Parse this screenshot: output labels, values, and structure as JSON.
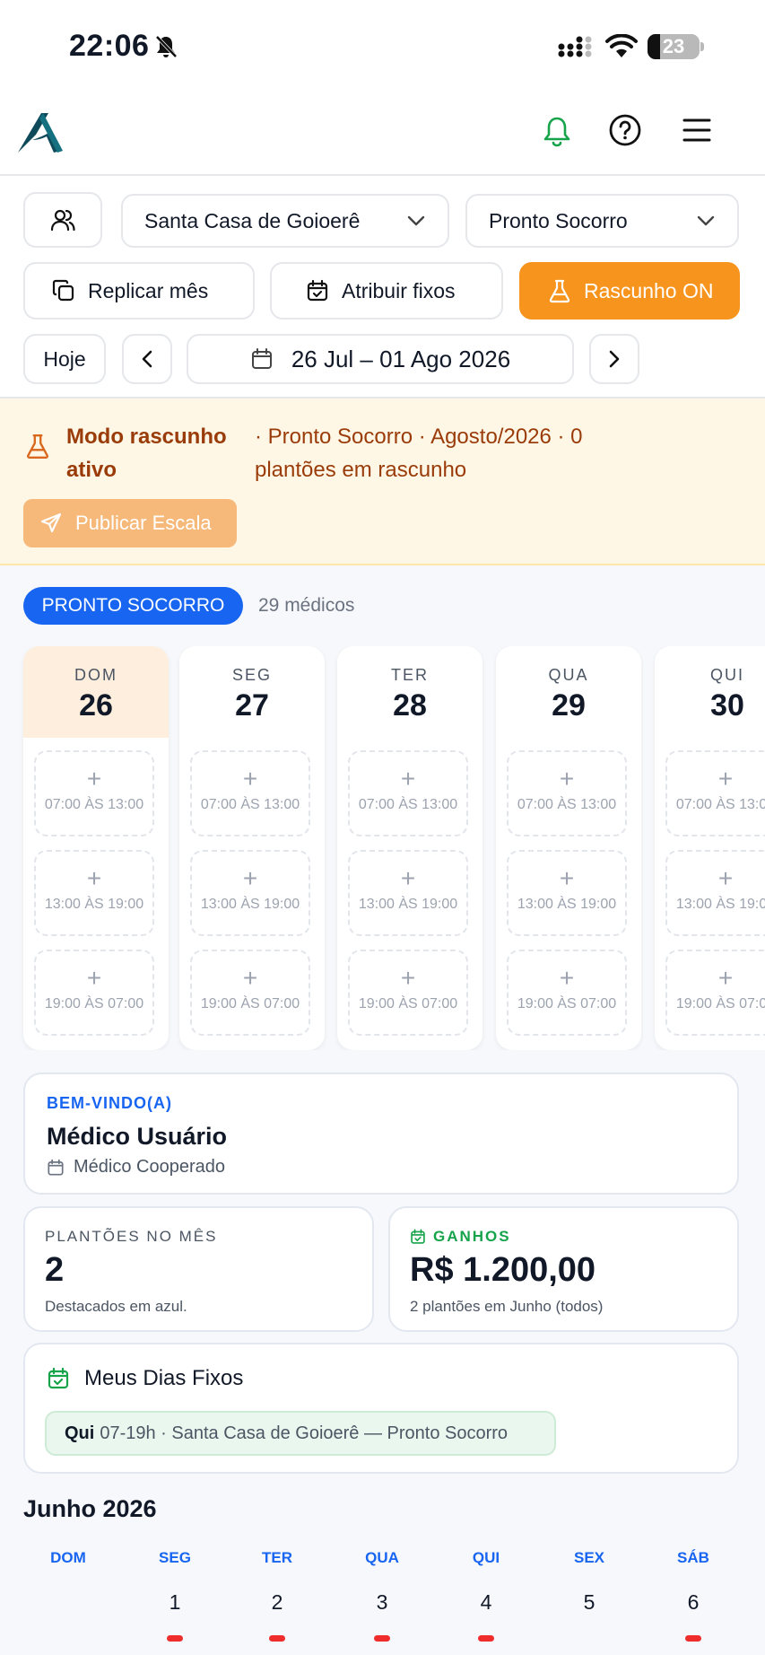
{
  "status_bar": {
    "time": "22:06",
    "battery": "23"
  },
  "filters": {
    "hospital": "Santa Casa de Goioerê",
    "sector": "Pronto Socorro"
  },
  "actions": {
    "replicate": "Replicar mês",
    "assign_fixed": "Atribuir fixos",
    "draft": "Rascunho ON"
  },
  "nav": {
    "today": "Hoje",
    "range": "26 Jul – 01 Ago 2026"
  },
  "banner": {
    "title": "Modo rascunho ativo",
    "text": "· Pronto Socorro · Agosto/2026 · 0 plantões em rascunho",
    "publish": "Publicar Escala"
  },
  "sector": {
    "badge": "PRONTO SOCORRO",
    "count": "29 médicos"
  },
  "week": {
    "days": [
      {
        "name": "DOM",
        "num": "26"
      },
      {
        "name": "SEG",
        "num": "27"
      },
      {
        "name": "TER",
        "num": "28"
      },
      {
        "name": "QUA",
        "num": "29"
      },
      {
        "name": "QUI",
        "num": "30"
      }
    ],
    "slots": [
      "07:00 ÀS 13:00",
      "13:00 ÀS 19:00",
      "19:00 ÀS 07:00"
    ],
    "plus": "+"
  },
  "welcome": {
    "kicker": "BEM-VINDO(A)",
    "name": "Médico Usuário",
    "role": "Médico Cooperado"
  },
  "stats": {
    "shifts_label": "PLANTÕES NO MÊS",
    "shifts_value": "2",
    "shifts_sub": "Destacados em azul.",
    "earnings_label": "GANHOS",
    "earnings_value": "R$ 1.200,00",
    "earnings_sub": "2 plantões em Junho (todos)"
  },
  "fixed_days": {
    "title": "Meus Dias Fixos",
    "day": "Qui",
    "detail": "07-19h · Santa Casa de Goioerê — Pronto Socorro"
  },
  "calendar": {
    "title": "Junho 2026",
    "weekdays": [
      "DOM",
      "SEG",
      "TER",
      "QUA",
      "QUI",
      "SEX",
      "SÁB"
    ],
    "first_row": [
      "",
      "1",
      "2",
      "3",
      "4",
      "5",
      "6"
    ],
    "marked_days": [
      "1",
      "2",
      "3",
      "4",
      "6"
    ]
  },
  "colors": {
    "accent_blue": "#1765f0",
    "draft_orange": "#f7941d",
    "success_green": "#16a34a",
    "warning_text": "#9a3c0a",
    "marker_red": "#ef2d2d"
  }
}
